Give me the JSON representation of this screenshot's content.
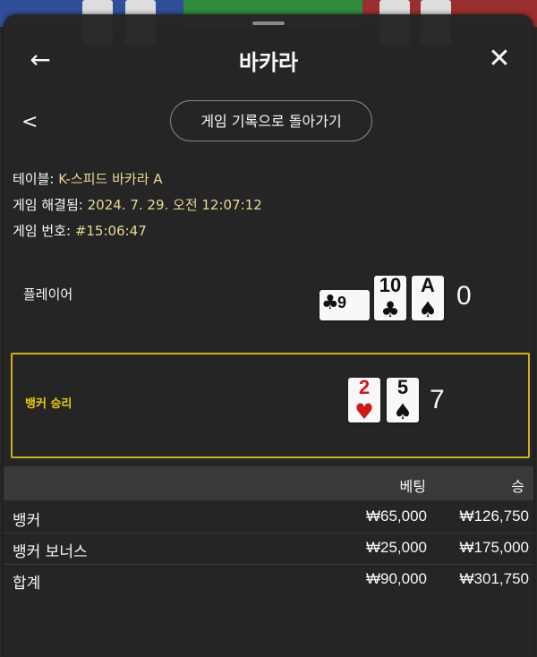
{
  "header": {
    "title": "바카라"
  },
  "subheader": {
    "history_button": "게임 기록으로 돌아가기"
  },
  "info": {
    "table_label": "테이블:",
    "table_value": "K-스피드 바카라 A",
    "resolved_label": "게임 해결됨:",
    "resolved_value": "2024. 7. 29. 오전 12:07:12",
    "number_label": "게임 번호:",
    "number_value": "#15:06:47"
  },
  "player": {
    "label": "플레이어",
    "cards": [
      {
        "rank": "9",
        "suit": "♣",
        "color": "black",
        "orientation": "sideways"
      },
      {
        "rank": "10",
        "suit": "♣",
        "color": "black"
      },
      {
        "rank": "A",
        "suit": "♠",
        "color": "black"
      }
    ],
    "score": "0"
  },
  "banker": {
    "label": "뱅커 승리",
    "cards": [
      {
        "rank": "2",
        "suit": "♥",
        "color": "red"
      },
      {
        "rank": "5",
        "suit": "♠",
        "color": "black"
      }
    ],
    "score": "7"
  },
  "bets": {
    "headers": {
      "bet": "베팅",
      "win": "승"
    },
    "rows": [
      {
        "name": "뱅커",
        "bet": "₩65,000",
        "win": "₩126,750"
      },
      {
        "name": "뱅커 보너스",
        "bet": "₩25,000",
        "win": "₩175,000"
      }
    ],
    "total": {
      "name": "합계",
      "bet": "₩90,000",
      "win": "₩301,750"
    }
  },
  "colors": {
    "accent_gold": "#d8b41c",
    "banker_label": "#f0d010",
    "info_value": "#f3df9a"
  }
}
